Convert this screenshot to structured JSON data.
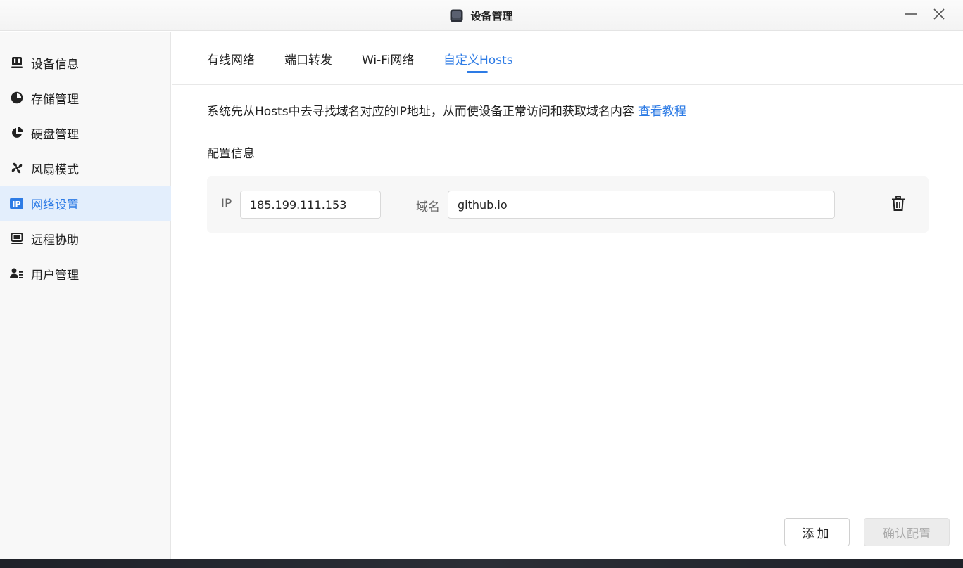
{
  "window": {
    "title": "设备管理",
    "minimize_icon": "minus-icon",
    "close_icon": "close-icon"
  },
  "sidebar": {
    "items": [
      {
        "label": "设备信息",
        "icon": "device-info-icon"
      },
      {
        "label": "存储管理",
        "icon": "pie-chart-icon"
      },
      {
        "label": "硬盘管理",
        "icon": "disk-pie-icon"
      },
      {
        "label": "风扇模式",
        "icon": "fan-icon"
      },
      {
        "label": "网络设置",
        "icon": "ip-icon",
        "icon_text": "IP",
        "active": true
      },
      {
        "label": "远程协助",
        "icon": "monitor-icon"
      },
      {
        "label": "用户管理",
        "icon": "users-icon"
      }
    ]
  },
  "tabs": [
    {
      "label": "有线网络"
    },
    {
      "label": "端口转发"
    },
    {
      "label": "Wi-Fi网络"
    },
    {
      "label": "自定义Hosts",
      "active": true
    }
  ],
  "content": {
    "description": "系统先从Hosts中去寻找域名对应的IP地址，从而使设备正常访问和获取域名内容",
    "tutorial_link": "查看教程",
    "section_label": "配置信息",
    "hosts": [
      {
        "ip_label": "IP",
        "ip_value": "185.199.111.153",
        "domain_label": "域名",
        "domain_value": "github.io",
        "delete_icon": "trash-icon"
      }
    ]
  },
  "footer": {
    "add_label": "添加",
    "confirm_label": "确认配置"
  },
  "colors": {
    "accent": "#2d7be5",
    "active_bg": "#e3eefc",
    "disabled_text": "#aaaaaa"
  }
}
